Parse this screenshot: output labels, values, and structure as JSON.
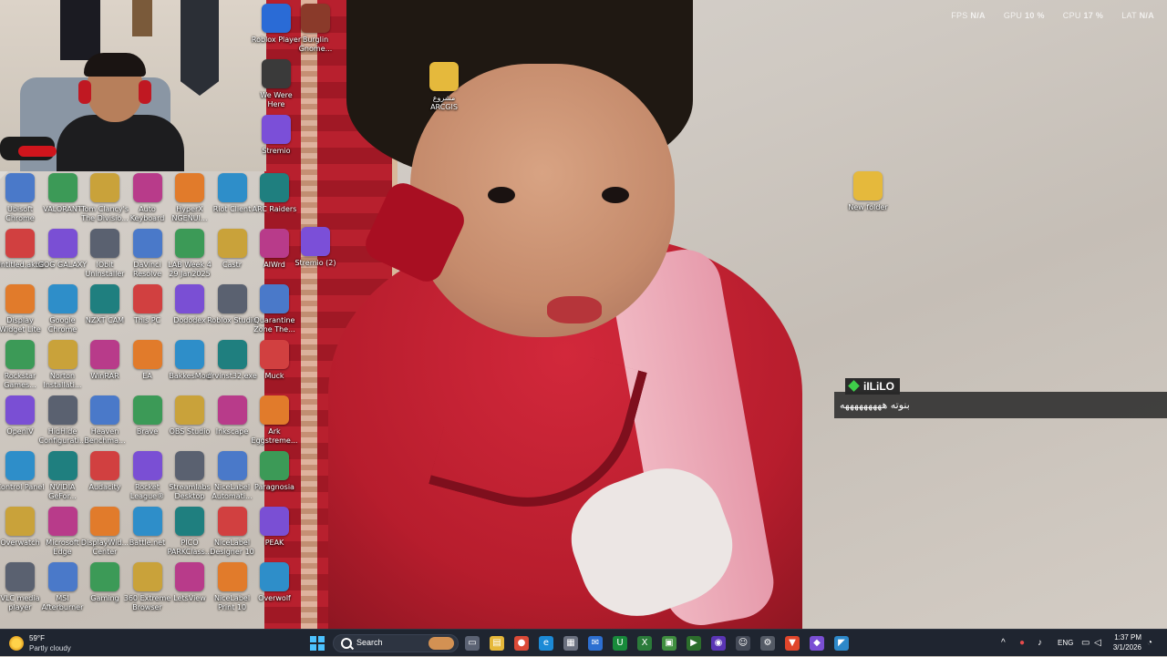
{
  "perf": {
    "fps_label": "FPS",
    "fps_value": "N/A",
    "gpu_label": "GPU",
    "gpu_value": "10 %",
    "cpu_label": "CPU",
    "cpu_value": "17 %",
    "lat_label": "LAT",
    "lat_value": "N/A"
  },
  "chat": {
    "username": "iILiLO",
    "message": "بنوته هههههههههه"
  },
  "desktop_icons": {
    "col1": [
      "Ubisoft Chrome",
      "Untitled.akbd",
      "Display Widget Lite",
      "Rockstar Games...",
      "OpenIV",
      "Control Panel",
      "Overwatch",
      "VLC media player"
    ],
    "col2": [
      "VALORANT",
      "GOG GALAXY",
      "Google Chrome",
      "Norton Installati...",
      "HidHide Configurati...",
      "NVIDIA GeFor...",
      "Microsoft Edge",
      "MSI Afterburner"
    ],
    "col3": [
      "Tom Clancy's The Divisio...",
      "IObit Uninstaller",
      "NZXT CAM",
      "WinRAR",
      "Heaven Benchma...",
      "Audacity",
      "DisplayWid... Center",
      "Gaming"
    ],
    "col4": [
      "Auto Keyboard",
      "DaVinci Resolve",
      "This PC",
      "EA",
      "Brave",
      "Rocket League®",
      "Battle.net",
      "360 Extreme Browser"
    ],
    "col5": [
      "HyperX NGENUI...",
      "LAB Week 4 29 Jan2025",
      "Dododex",
      "BakkesMod",
      "OBS Studio",
      "Streamlabs Desktop",
      "PICO PARKClass...",
      "LetsView"
    ],
    "col6": [
      "Riot Client",
      "Castr",
      "Roblox Studio",
      "drvinst32.exe",
      "Inkscape",
      "NiceLabel Automati...",
      "NiceLabel Designer 10",
      "NiceLabel Print 10"
    ],
    "col7": [
      "ARC Raiders",
      "AIWrd",
      "Quarantine Zone The...",
      "Muck",
      "Ark Eggstreme...",
      "Paragnosia",
      "PEAK",
      "Overwolf"
    ],
    "top_col7": [
      "Roblox Player",
      "We Were Here",
      "Stremio"
    ],
    "top_col8": [
      "Burglin Gnome..."
    ],
    "stremio2": "Stremio (2)",
    "arcgis": "مشروع ARCGIS",
    "new_folder": "New folder"
  },
  "taskbar": {
    "weather_temp": "59°F",
    "weather_cond": "Partly cloudy",
    "search_text": "Search",
    "lang": "ENG",
    "time": "1:37 PM",
    "date": "3/1/2026"
  },
  "colors": {
    "taskbar_bg": "#1f2530",
    "accent": "#4cc2ff",
    "chat_accent": "#3fcf4a"
  }
}
